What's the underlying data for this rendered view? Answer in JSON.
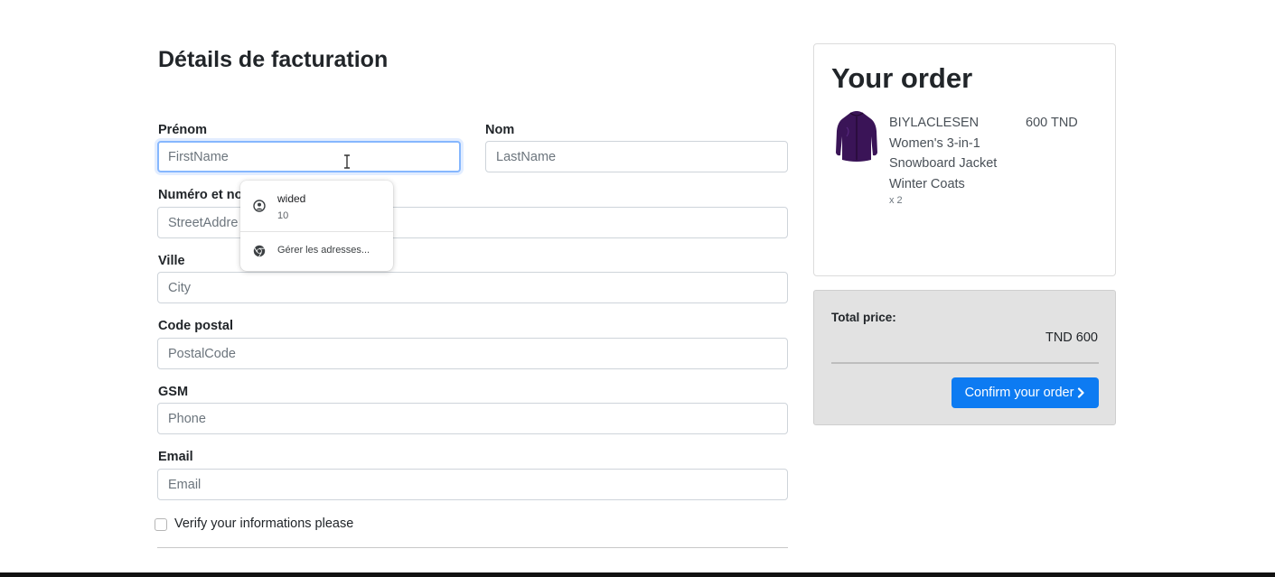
{
  "billing": {
    "title": "Détails de facturation",
    "first_name": {
      "label": "Prénom",
      "placeholder": "FirstName"
    },
    "last_name": {
      "label": "Nom",
      "placeholder": "LastName"
    },
    "street": {
      "label": "Numéro et no",
      "placeholder": "StreetAddre"
    },
    "city": {
      "label": "Ville",
      "placeholder": "City"
    },
    "postal_code": {
      "label": "Code postal",
      "placeholder": "PostalCode"
    },
    "phone": {
      "label": "GSM",
      "placeholder": "Phone"
    },
    "email": {
      "label": "Email",
      "placeholder": "Email"
    },
    "verify_label": "Verify your informations please"
  },
  "autofill": {
    "suggestion_name": "wided",
    "suggestion_sub": "10",
    "manage_label": "Gérer les adresses...",
    "icons": {
      "suggestion": "user-circle-icon",
      "manage": "chrome-icon"
    }
  },
  "order": {
    "title": "Your order",
    "items": [
      {
        "name": "BIYLACLESEN Women's 3-in-1 Snowboard Jacket Winter Coats",
        "price": "600 TND",
        "quantity": "x 2",
        "image": "purple-jacket-image"
      }
    ]
  },
  "totals": {
    "label": "Total price:",
    "value": "TND 600",
    "confirm_label": "Confirm your order",
    "confirm_icon": "chevron-right-icon"
  },
  "colors": {
    "primary_button": "#0d7bf2",
    "total_panel_bg": "#e2e2e2",
    "focus_border": "#86b7fe",
    "product_purple": "#3a1457"
  }
}
